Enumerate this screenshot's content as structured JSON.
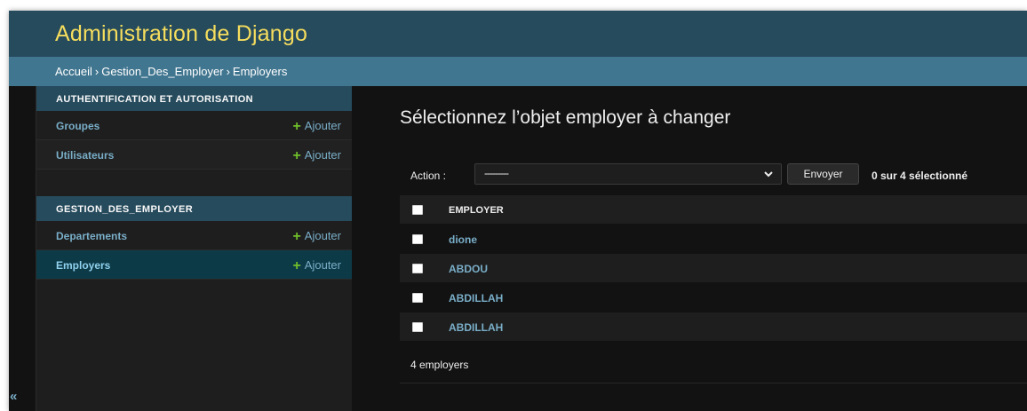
{
  "header": {
    "brand": "Administration de Django"
  },
  "breadcrumbs": {
    "home": "Accueil",
    "app": "Gestion_Des_Employer",
    "current": "Employers",
    "separator": "›"
  },
  "sidebar": {
    "collapse_label": "«",
    "modules": [
      {
        "caption": "AUTHENTIFICATION ET AUTORISATION",
        "models": [
          {
            "name": "Groupes",
            "add_label": "Ajouter"
          },
          {
            "name": "Utilisateurs",
            "add_label": "Ajouter"
          }
        ]
      },
      {
        "caption": "GESTION_DES_EMPLOYER",
        "models": [
          {
            "name": "Departements",
            "add_label": "Ajouter"
          },
          {
            "name": "Employers",
            "add_label": "Ajouter",
            "current": true
          }
        ]
      }
    ]
  },
  "content": {
    "title": "Sélectionnez l’objet employer à changer",
    "actions": {
      "label": "Action :",
      "selected_value": "---------",
      "submit_label": "Envoyer",
      "counter": "0 sur 4 sélectionné"
    },
    "table": {
      "column_header": "EMPLOYER",
      "rows": [
        "dione",
        "ABDOU",
        "ABDILLAH",
        "ABDILLAH"
      ]
    },
    "paginator": "4 employers"
  },
  "icons": {
    "add": "plus-icon",
    "select": "chevron-down-icon",
    "collapse": "double-chevron-left-icon"
  },
  "colors": {
    "header_bg": "#264b5d",
    "brand": "#f5dd5d",
    "breadcrumbs_bg": "#417690",
    "link": "#79aec8",
    "add_plus": "#70bf2b",
    "background": "#121212"
  }
}
